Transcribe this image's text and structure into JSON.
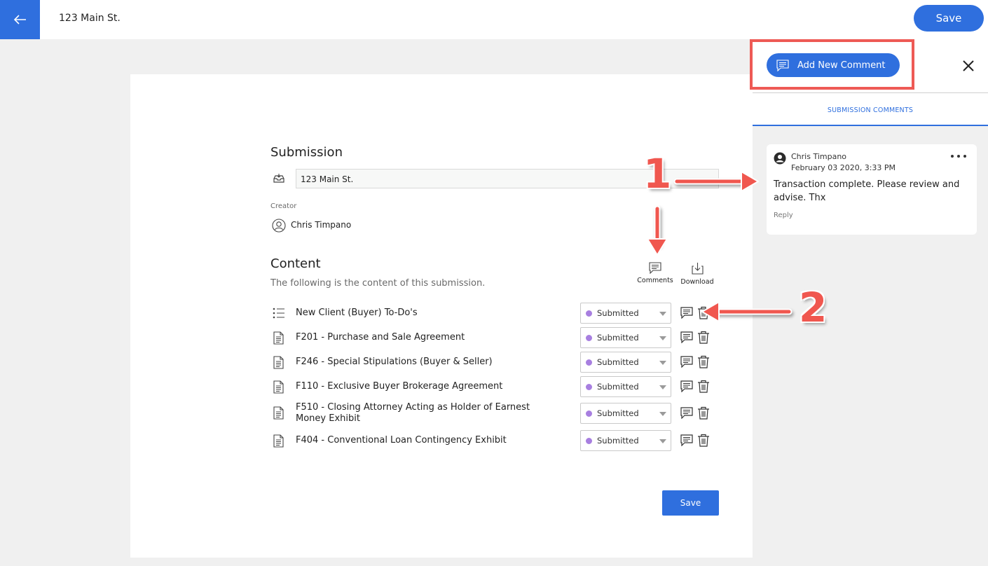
{
  "header": {
    "title": "123 Main St.",
    "save_label": "Save"
  },
  "submission": {
    "heading": "Submission",
    "name_value": "123 Main St.",
    "creator_label": "Creator",
    "creator_name": "Chris Timpano"
  },
  "content": {
    "heading": "Content",
    "description": "The following is the content of this submission.",
    "comments_label": "Comments",
    "download_label": "Download",
    "items": [
      {
        "label": "New Client (Buyer) To-Do's",
        "status": "Submitted",
        "icon": "checklist-icon"
      },
      {
        "label": "F201 - Purchase and Sale Agreement",
        "status": "Submitted",
        "icon": "document-icon"
      },
      {
        "label": "F246 - Special Stipulations (Buyer & Seller)",
        "status": "Submitted",
        "icon": "document-icon"
      },
      {
        "label": "F110 - Exclusive Buyer Brokerage Agreement",
        "status": "Submitted",
        "icon": "document-icon"
      },
      {
        "label": "F510 - Closing Attorney Acting as Holder of Earnest Money Exhibit",
        "status": "Submitted",
        "icon": "document-icon"
      },
      {
        "label": "F404 - Conventional Loan Contingency Exhibit",
        "status": "Submitted",
        "icon": "document-icon"
      }
    ],
    "save_label": "Save"
  },
  "comments_panel": {
    "add_button_label": "Add New Comment",
    "tab_label": "SUBMISSION COMMENTS",
    "comments": [
      {
        "author": "Chris Timpano",
        "date": "February 03 2020, 3:33 PM",
        "body": "Transaction complete. Please review and advise. Thx",
        "reply_label": "Reply"
      }
    ]
  },
  "annotations": {
    "marker_1": "1",
    "marker_2": "2"
  },
  "colors": {
    "accent": "#2f6fde",
    "annotation": "#f0574f",
    "status_dot": "#a87fe0"
  }
}
